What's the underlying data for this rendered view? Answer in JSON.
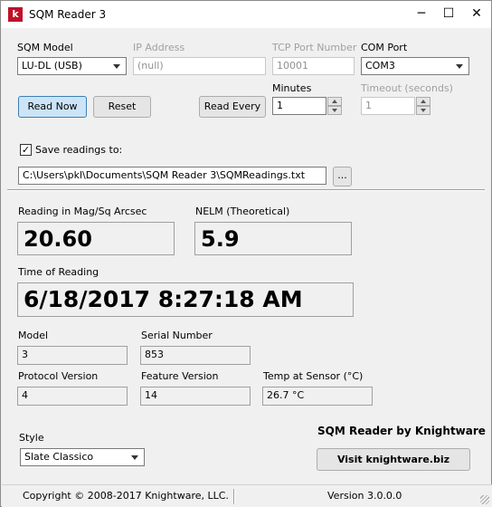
{
  "window": {
    "title": "SQM Reader 3",
    "icon_letter": "k",
    "minimize": "─",
    "maximize": "☐",
    "close": "✕"
  },
  "connection": {
    "model_label": "SQM Model",
    "model_value": "LU-DL (USB)",
    "ip_label": "IP Address",
    "ip_value": "(null)",
    "tcp_label": "TCP Port Number",
    "tcp_value": "10001",
    "com_label": "COM Port",
    "com_value": "COM3"
  },
  "actions": {
    "read_now": "Read Now",
    "reset": "Reset",
    "read_every": "Read Every",
    "minutes_label": "Minutes",
    "minutes_value": "1",
    "timeout_label": "Timeout (seconds)",
    "timeout_value": "1"
  },
  "save": {
    "checkbox_label": "Save readings to:",
    "checked_glyph": "✓",
    "path": "C:\\Users\\pkl\\Documents\\SQM Reader 3\\SQMReadings.txt",
    "browse": "..."
  },
  "reading": {
    "mag_label": "Reading in Mag/Sq Arcsec",
    "mag_value": "20.60",
    "nelm_label": "NELM (Theoretical)",
    "nelm_value": "5.9",
    "time_label": "Time of Reading",
    "time_value": "6/18/2017 8:27:18 AM"
  },
  "device": {
    "model_label": "Model",
    "model_value": "3",
    "serial_label": "Serial Number",
    "serial_value": "853",
    "protocol_label": "Protocol Version",
    "protocol_value": "4",
    "feature_label": "Feature Version",
    "feature_value": "14",
    "temp_label": "Temp at Sensor (°C)",
    "temp_value": "26.7 °C"
  },
  "style": {
    "label": "Style",
    "value": "Slate Classico"
  },
  "brand": {
    "title": "SQM Reader by Knightware",
    "visit_button": "Visit knightware.biz"
  },
  "statusbar": {
    "copyright": "Copyright © 2008-2017 Knightware, LLC.",
    "version": "Version 3.0.0.0"
  }
}
